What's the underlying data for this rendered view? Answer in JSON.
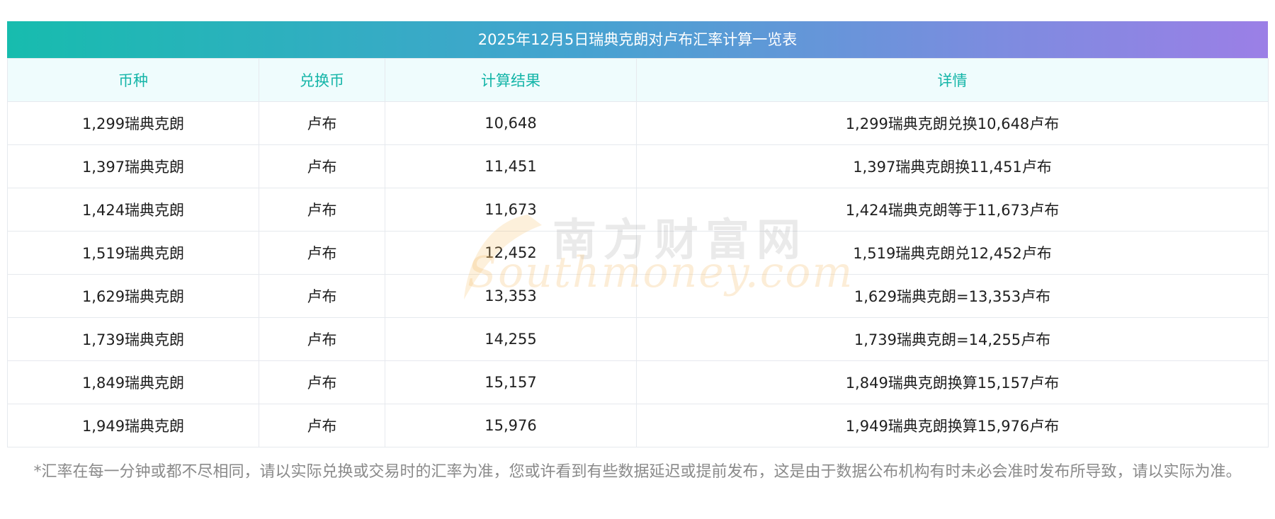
{
  "title": "2025年12月5日瑞典克朗对卢布汇率计算一览表",
  "headers": [
    "币种",
    "兑换币",
    "计算结果",
    "详情"
  ],
  "rows": [
    {
      "currency": "1,299瑞典克朗",
      "target": "卢布",
      "result": "10,648",
      "detail": "1,299瑞典克朗兑换10,648卢布"
    },
    {
      "currency": "1,397瑞典克朗",
      "target": "卢布",
      "result": "11,451",
      "detail": "1,397瑞典克朗换11,451卢布"
    },
    {
      "currency": "1,424瑞典克朗",
      "target": "卢布",
      "result": "11,673",
      "detail": "1,424瑞典克朗等于11,673卢布"
    },
    {
      "currency": "1,519瑞典克朗",
      "target": "卢布",
      "result": "12,452",
      "detail": "1,519瑞典克朗兑12,452卢布"
    },
    {
      "currency": "1,629瑞典克朗",
      "target": "卢布",
      "result": "13,353",
      "detail": "1,629瑞典克朗=13,353卢布"
    },
    {
      "currency": "1,739瑞典克朗",
      "target": "卢布",
      "result": "14,255",
      "detail": "1,739瑞典克朗=14,255卢布"
    },
    {
      "currency": "1,849瑞典克朗",
      "target": "卢布",
      "result": "15,157",
      "detail": "1,849瑞典克朗换算15,157卢布"
    },
    {
      "currency": "1,949瑞典克朗",
      "target": "卢布",
      "result": "15,976",
      "detail": "1,949瑞典克朗换算15,976卢布"
    }
  ],
  "watermark": {
    "cn": "南方财富网",
    "en": "Southmoney.com"
  },
  "footnote": "*汇率在每一分钟或都不尽相同，请以实际兑换或交易时的汇率为准，您或许看到有些数据延迟或提前发布，这是由于数据公布机构有时未必会准时发布所导致，请以实际为准。",
  "colors": {
    "header_text": "#14b5a8",
    "gradient_start": "#17bcae",
    "gradient_end": "#9b7fe6"
  }
}
